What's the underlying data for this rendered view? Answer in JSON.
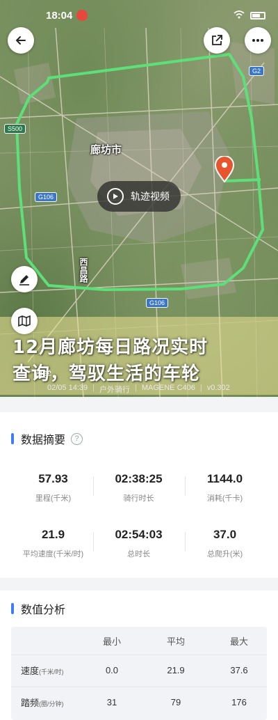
{
  "status": {
    "time": "18:04"
  },
  "map": {
    "city_label": "廊坊市",
    "road_tags": [
      "S500",
      "G106",
      "G106",
      "G2"
    ],
    "vertical_label": "西昌路",
    "video_button": "轨迹视频",
    "icons": {
      "back": "back-arrow-icon",
      "share": "share-icon",
      "more": "more-icon",
      "edit": "edit-icon",
      "layers": "map-layers-icon",
      "pin": "location-pin-icon"
    },
    "colors": {
      "route": "#5de07a",
      "pin": "#e8542e"
    }
  },
  "headline": {
    "line1": "12月廊坊每日路况实时",
    "line2": "查询，驾驭生活的车轮",
    "meta_prefix": "同学",
    "date": "02/05 14:39",
    "activity": "户外骑行",
    "device": "MAGENE C406",
    "version": "v0.302"
  },
  "summary": {
    "title": "数据摘要",
    "stats": [
      {
        "value": "57.93",
        "label": "里程(千米)"
      },
      {
        "value": "02:38:25",
        "label": "骑行时长"
      },
      {
        "value": "1144.0",
        "label": "消耗(千卡)"
      },
      {
        "value": "21.9",
        "label": "平均速度(千米/时)"
      },
      {
        "value": "02:54:03",
        "label": "总时长"
      },
      {
        "value": "37.0",
        "label": "总爬升(米)"
      }
    ]
  },
  "analysis": {
    "title": "数值分析",
    "columns": [
      "最小",
      "平均",
      "最大"
    ],
    "rows": [
      {
        "name": "速度",
        "unit": "(千米/时)",
        "min": "0.0",
        "avg": "21.9",
        "max": "37.6"
      },
      {
        "name": "踏频",
        "unit": "(圈/分钟)",
        "min": "31",
        "avg": "79",
        "max": "176"
      }
    ]
  }
}
